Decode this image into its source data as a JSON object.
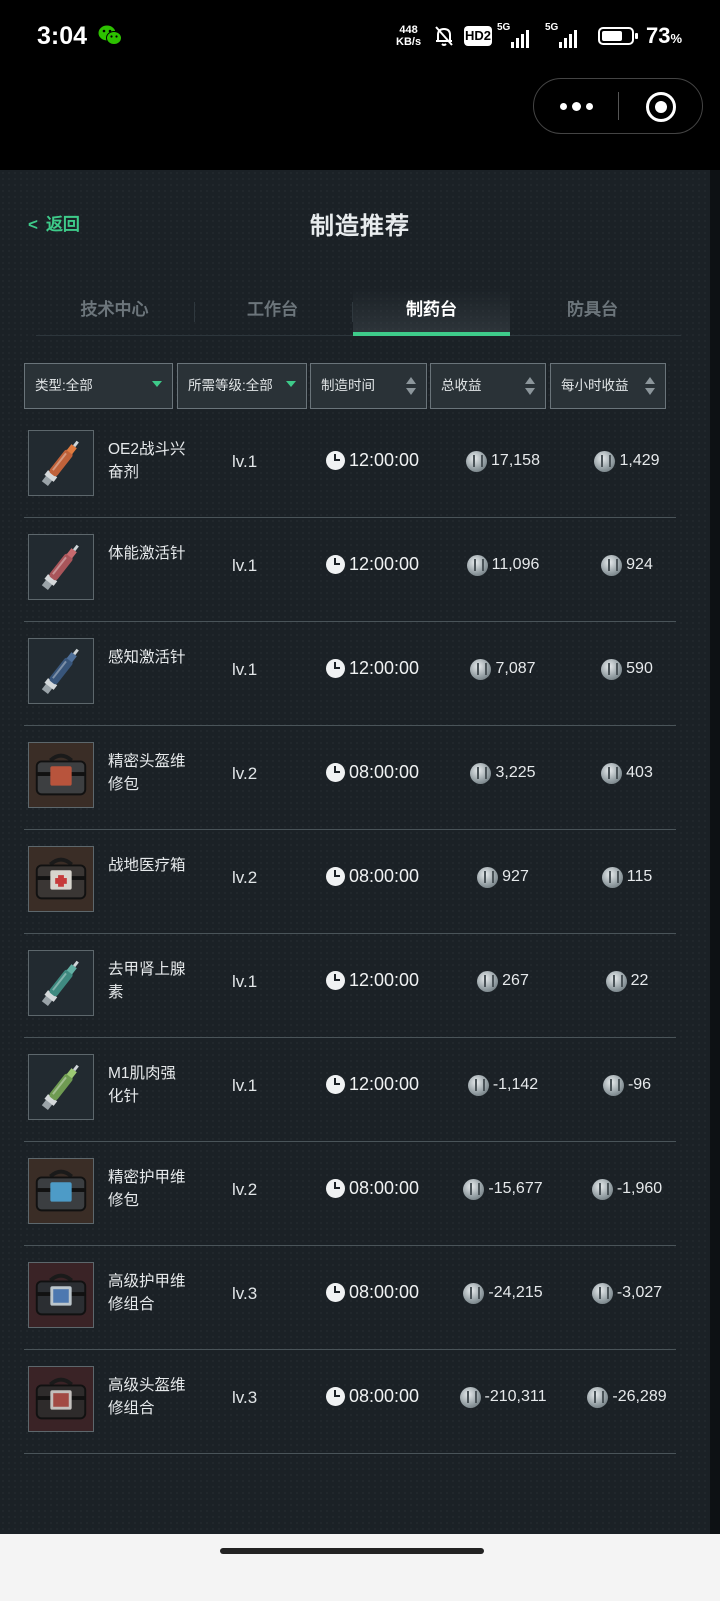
{
  "status_bar": {
    "time": "3:04",
    "speed_value": "448",
    "speed_unit": "KB/s",
    "hd_label": "HD2",
    "sim1_label": "5G",
    "sim2_label": "5G",
    "battery_percent": "73",
    "battery_level": 0.73,
    "percent_sign": "%"
  },
  "header": {
    "back_label": "返回",
    "title": "制造推荐"
  },
  "tabs": [
    {
      "label": "技术中心",
      "active": false
    },
    {
      "label": "工作台",
      "active": false
    },
    {
      "label": "制药台",
      "active": true
    },
    {
      "label": "防具台",
      "active": false
    }
  ],
  "filters": {
    "type": "类型:全部",
    "level": "所需等级:全部",
    "time": "制造时间",
    "total": "总收益",
    "hourly": "每小时收益"
  },
  "colors": {
    "accent": "#3ecb8a",
    "background": "#1b2126"
  },
  "items": [
    {
      "name": "OE2战斗兴奋剂",
      "level": "lv.1",
      "time": "12:00:00",
      "total": "17,158",
      "hourly": "1,429",
      "icon": "syringe-orange-icon"
    },
    {
      "name": "体能激活针",
      "level": "lv.1",
      "time": "12:00:00",
      "total": "11,096",
      "hourly": "924",
      "icon": "syringe-red-icon"
    },
    {
      "name": "感知激活针",
      "level": "lv.1",
      "time": "12:00:00",
      "total": "7,087",
      "hourly": "590",
      "icon": "syringe-blue-icon"
    },
    {
      "name": "精密头盔维修包",
      "level": "lv.2",
      "time": "08:00:00",
      "total": "3,225",
      "hourly": "403",
      "icon": "helmet-repair-kit-icon"
    },
    {
      "name": "战地医疗箱",
      "level": "lv.2",
      "time": "08:00:00",
      "total": "927",
      "hourly": "115",
      "icon": "medkit-icon"
    },
    {
      "name": "去甲肾上腺素",
      "level": "lv.1",
      "time": "12:00:00",
      "total": "267",
      "hourly": "22",
      "icon": "syringe-teal-icon"
    },
    {
      "name": "M1肌肉强化针",
      "level": "lv.1",
      "time": "12:00:00",
      "total": "-1,142",
      "hourly": "-96",
      "icon": "syringe-green-icon"
    },
    {
      "name": "精密护甲维修包",
      "level": "lv.2",
      "time": "08:00:00",
      "total": "-15,677",
      "hourly": "-1,960",
      "icon": "armor-repair-kit-icon"
    },
    {
      "name": "高级护甲维修组合",
      "level": "lv.3",
      "time": "08:00:00",
      "total": "-24,215",
      "hourly": "-3,027",
      "icon": "armor-repair-combo-icon"
    },
    {
      "name": "高级头盔维修组合",
      "level": "lv.3",
      "time": "08:00:00",
      "total": "-210,311",
      "hourly": "-26,289",
      "icon": "helmet-repair-combo-icon"
    }
  ]
}
